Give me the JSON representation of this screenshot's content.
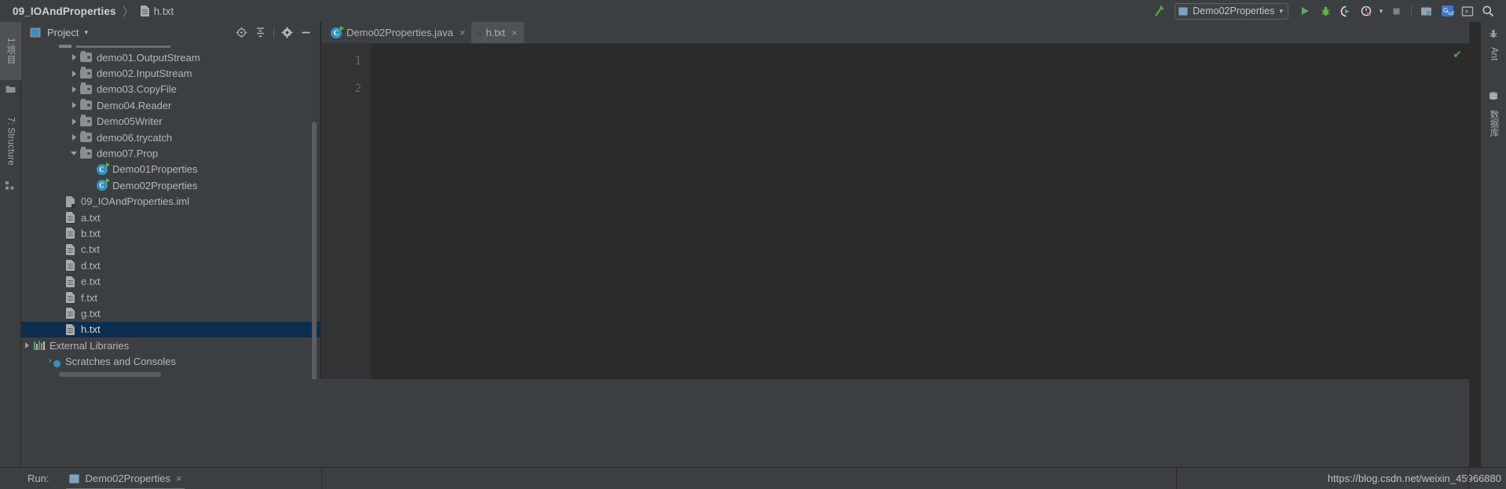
{
  "window": {
    "theme_bg": "#3c3f41",
    "editor_bg": "#2b2b2b",
    "accent": "#3592c4",
    "selection_bg": "#0d2e4e"
  },
  "breadcrumb": {
    "project": "09_IOAndProperties",
    "separator": "〉",
    "file": "h.txt",
    "file_icon": "text-file-icon"
  },
  "toolbar": {
    "build_icon": "hammer-icon",
    "run_config": {
      "icon": "run-configuration-icon",
      "label": "Demo02Properties",
      "chevron": "▾"
    },
    "run_icon": "run-play-icon",
    "debug_icon": "debug-bug-icon",
    "coverage_icon": "run-with-coverage-icon",
    "profile_icon": "profiler-icon",
    "profile_chevron": "▾",
    "stop_icon": "stop-icon",
    "project_structure_icon": "project-structure-icon",
    "translate_icon": "translate-icon",
    "terminal_icon": "terminal-icon",
    "search_icon": "search-everywhere-icon"
  },
  "left_strip": {
    "tabs": [
      {
        "label": "1:项目",
        "icon": "project-tool-window-icon",
        "active": true
      },
      {
        "label": "7: Structure",
        "icon": "structure-tool-window-icon",
        "active": false
      }
    ]
  },
  "right_strip": {
    "tabs": [
      {
        "label": "Ant",
        "icon": "ant-icon"
      },
      {
        "label": "数据库",
        "icon": "database-icon"
      }
    ]
  },
  "project_panel": {
    "title": "Project",
    "chevron": "▾",
    "header_icons": [
      {
        "name": "scroll-from-source-icon",
        "glyph": "⊕"
      },
      {
        "name": "collapse-all-icon",
        "glyph": "≡"
      },
      {
        "name": "settings-gear-icon",
        "glyph": "⚙"
      },
      {
        "name": "hide-panel-icon",
        "glyph": "—"
      }
    ],
    "tree": [
      {
        "label": "demo01.OutputStream",
        "icon": "package-folder-icon",
        "indent": 3,
        "arrow": "collapsed",
        "selected": false
      },
      {
        "label": "demo02.InputStream",
        "icon": "package-folder-icon",
        "indent": 3,
        "arrow": "collapsed",
        "selected": false
      },
      {
        "label": "demo03.CopyFile",
        "icon": "package-folder-icon",
        "indent": 3,
        "arrow": "collapsed",
        "selected": false
      },
      {
        "label": "Demo04.Reader",
        "icon": "package-folder-icon",
        "indent": 3,
        "arrow": "collapsed",
        "selected": false
      },
      {
        "label": "Demo05Writer",
        "icon": "package-folder-icon",
        "indent": 3,
        "arrow": "collapsed",
        "selected": false
      },
      {
        "label": "demo06.trycatch",
        "icon": "package-folder-icon",
        "indent": 3,
        "arrow": "collapsed",
        "selected": false
      },
      {
        "label": "demo07.Prop",
        "icon": "package-folder-icon",
        "indent": 3,
        "arrow": "expanded",
        "selected": false
      },
      {
        "label": "Demo01Properties",
        "icon": "java-class-icon",
        "indent": 4,
        "arrow": "none",
        "selected": false
      },
      {
        "label": "Demo02Properties",
        "icon": "java-class-icon",
        "indent": 4,
        "arrow": "none",
        "selected": false
      },
      {
        "label": "09_IOAndProperties.iml",
        "icon": "iml-module-file-icon",
        "indent": 2,
        "arrow": "none",
        "selected": false
      },
      {
        "label": "a.txt",
        "icon": "text-file-icon",
        "indent": 2,
        "arrow": "none",
        "selected": false
      },
      {
        "label": "b.txt",
        "icon": "text-file-icon",
        "indent": 2,
        "arrow": "none",
        "selected": false
      },
      {
        "label": "c.txt",
        "icon": "text-file-icon",
        "indent": 2,
        "arrow": "none",
        "selected": false
      },
      {
        "label": "d.txt",
        "icon": "text-file-icon",
        "indent": 2,
        "arrow": "none",
        "selected": false
      },
      {
        "label": "e.txt",
        "icon": "text-file-icon",
        "indent": 2,
        "arrow": "none",
        "selected": false
      },
      {
        "label": "f.txt",
        "icon": "text-file-icon",
        "indent": 2,
        "arrow": "none",
        "selected": false
      },
      {
        "label": "g.txt",
        "icon": "text-file-icon",
        "indent": 2,
        "arrow": "none",
        "selected": false
      },
      {
        "label": "h.txt",
        "icon": "text-file-icon",
        "indent": 2,
        "arrow": "none",
        "selected": true
      },
      {
        "label": "External Libraries",
        "icon": "external-libraries-icon",
        "indent": 0,
        "arrow": "collapsed",
        "selected": false
      },
      {
        "label": "Scratches and Consoles",
        "icon": "scratches-icon",
        "indent": 1,
        "arrow": "none",
        "selected": false
      }
    ]
  },
  "editor": {
    "tabs": [
      {
        "label": "Demo02Properties.java",
        "icon": "java-class-icon",
        "active": false,
        "close": "×"
      },
      {
        "label": "h.txt",
        "icon": "text-file-icon",
        "active": true,
        "close": "×"
      }
    ],
    "line_numbers": [
      "1",
      "2"
    ],
    "content": "",
    "inspection_status_icon": "inspection-ok-check-icon",
    "inspection_status_glyph": "✔"
  },
  "bottom": {
    "run_label": "Run:",
    "run_tab": {
      "icon": "run-configuration-icon",
      "label": "Demo02Properties",
      "close": "×"
    },
    "watermark": "https://blog.csdn.net/weixin_45966880"
  }
}
